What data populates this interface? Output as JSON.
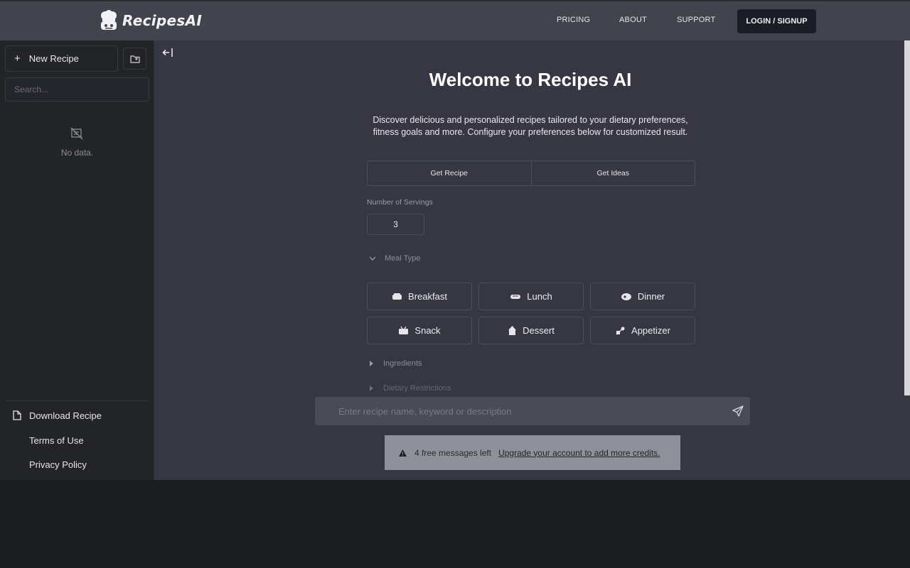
{
  "header": {
    "logo_text": "RecipesAI",
    "nav": [
      "PRICING",
      "ABOUT",
      "SUPPORT"
    ],
    "login_label": "LOGIN / SIGNUP"
  },
  "sidebar": {
    "new_recipe_label": "New Recipe",
    "search_placeholder": "Search...",
    "empty_text": "No data.",
    "footer_links": [
      "Download Recipe",
      "Terms of Use",
      "Privacy Policy"
    ]
  },
  "main": {
    "title": "Welcome to Recipes AI",
    "description": "Discover delicious and personalized recipes tailored to your dietary preferences, fitness goals and more. Configure your preferences below for customized result.",
    "tabs": [
      "Get Recipe",
      "Get Ideas"
    ],
    "servings_label": "Number of Servings",
    "servings_value": "3",
    "meal_type_label": "Meal Type",
    "meal_types": [
      "Breakfast",
      "Lunch",
      "Dinner",
      "Snack",
      "Dessert",
      "Appetizer"
    ],
    "ingredients_label": "Ingredients",
    "dietary_label": "Dietary Restrictions",
    "composer_placeholder": "Enter recipe name, keyword or description",
    "notice_text": "4 free messages left",
    "notice_link": "Upgrade your account to add more credits."
  },
  "colors": {
    "header_bg": "#41434d",
    "sidebar_bg": "#232428",
    "main_bg": "#363742",
    "login_bg": "#1a1c26",
    "notice_bg": "#8e909a"
  }
}
